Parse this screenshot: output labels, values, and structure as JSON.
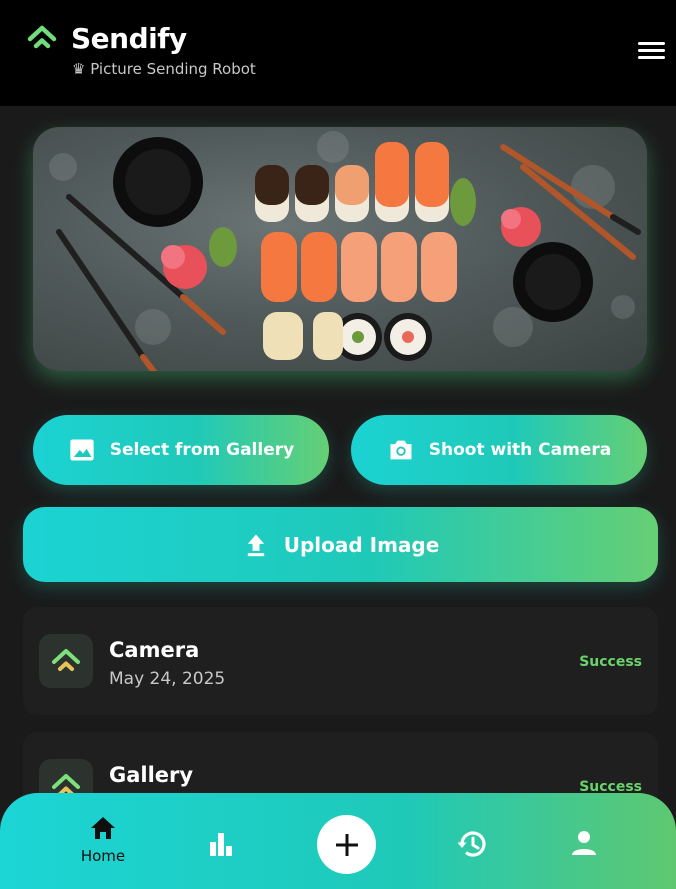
{
  "header": {
    "title": "Sendify",
    "subtitle": "♛ Picture Sending Robot",
    "logo_icon": "double-chevron-up-icon",
    "menu_icon": "hamburger-menu-icon"
  },
  "hero": {
    "image": "sushi-platter-photo"
  },
  "actions": {
    "gallery_label": "Select from Gallery",
    "camera_label": "Shoot with Camera",
    "upload_label": "Upload Image"
  },
  "history": [
    {
      "title": "Camera",
      "date": "May 24, 2025",
      "status": "Success"
    },
    {
      "title": "Gallery",
      "date": "",
      "status": "Success"
    }
  ],
  "nav": {
    "home_label": "Home",
    "items": [
      "home-icon",
      "bar-chart-icon",
      "plus-icon",
      "history-icon",
      "person-icon"
    ]
  },
  "colors": {
    "accent_teal": "#1cd3d3",
    "accent_green": "#66cf74",
    "success": "#6ad36b",
    "background": "#1a1a1a",
    "header": "#000000"
  }
}
